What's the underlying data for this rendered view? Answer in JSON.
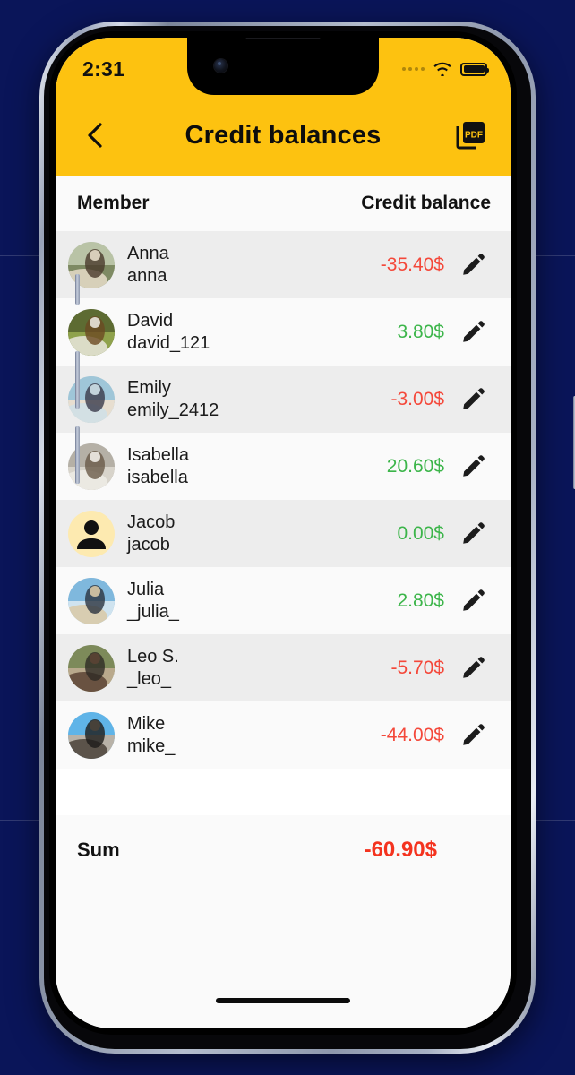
{
  "status_bar": {
    "time": "2:31",
    "cellular_icon": "cellular-dots-icon",
    "wifi_icon": "wifi-icon",
    "battery_icon": "battery-full-icon"
  },
  "app_bar": {
    "back_icon": "chevron-left-icon",
    "title": "Credit balances",
    "export_icon": "pdf-export-icon",
    "export_label": "PDF",
    "background_color": "#FDC210"
  },
  "list_header": {
    "member_column": "Member",
    "balance_column": "Credit balance"
  },
  "colors": {
    "negative": "#F4483A",
    "positive": "#3CB54A",
    "sum_negative": "#F4331F",
    "accent": "#FDC210",
    "row_alt": "#EDEDED",
    "row_plain": "#FAFAFA"
  },
  "members": [
    {
      "name": "Anna",
      "handle": "anna",
      "balance": "-35.40$",
      "sign": "neg",
      "avatar": "photo-woman-field",
      "edit_icon": "pencil-icon"
    },
    {
      "name": "David",
      "handle": "david_121",
      "balance": "3.80$",
      "sign": "pos",
      "avatar": "photo-man-boat",
      "edit_icon": "pencil-icon"
    },
    {
      "name": "Emily",
      "handle": "emily_2412",
      "balance": "-3.00$",
      "sign": "neg",
      "avatar": "photo-woman-beach",
      "edit_icon": "pencil-icon"
    },
    {
      "name": "Isabella",
      "handle": "isabella",
      "balance": "20.60$",
      "sign": "pos",
      "avatar": "photo-woman-wall",
      "edit_icon": "pencil-icon"
    },
    {
      "name": "Jacob",
      "handle": "jacob",
      "balance": "0.00$",
      "sign": "pos",
      "avatar": "placeholder-person",
      "edit_icon": "pencil-icon"
    },
    {
      "name": "Julia",
      "handle": "_julia_",
      "balance": "2.80$",
      "sign": "pos",
      "avatar": "photo-woman-jump",
      "edit_icon": "pencil-icon"
    },
    {
      "name": "Leo S.",
      "handle": "_leo_",
      "balance": "-5.70$",
      "sign": "neg",
      "avatar": "photo-man-shirt",
      "edit_icon": "pencil-icon"
    },
    {
      "name": "Mike",
      "handle": "mike_",
      "balance": "-44.00$",
      "sign": "neg",
      "avatar": "photo-man-camera",
      "edit_icon": "pencil-icon"
    }
  ],
  "summary": {
    "label": "Sum",
    "value": "-60.90$"
  },
  "home_indicator": "home-indicator"
}
